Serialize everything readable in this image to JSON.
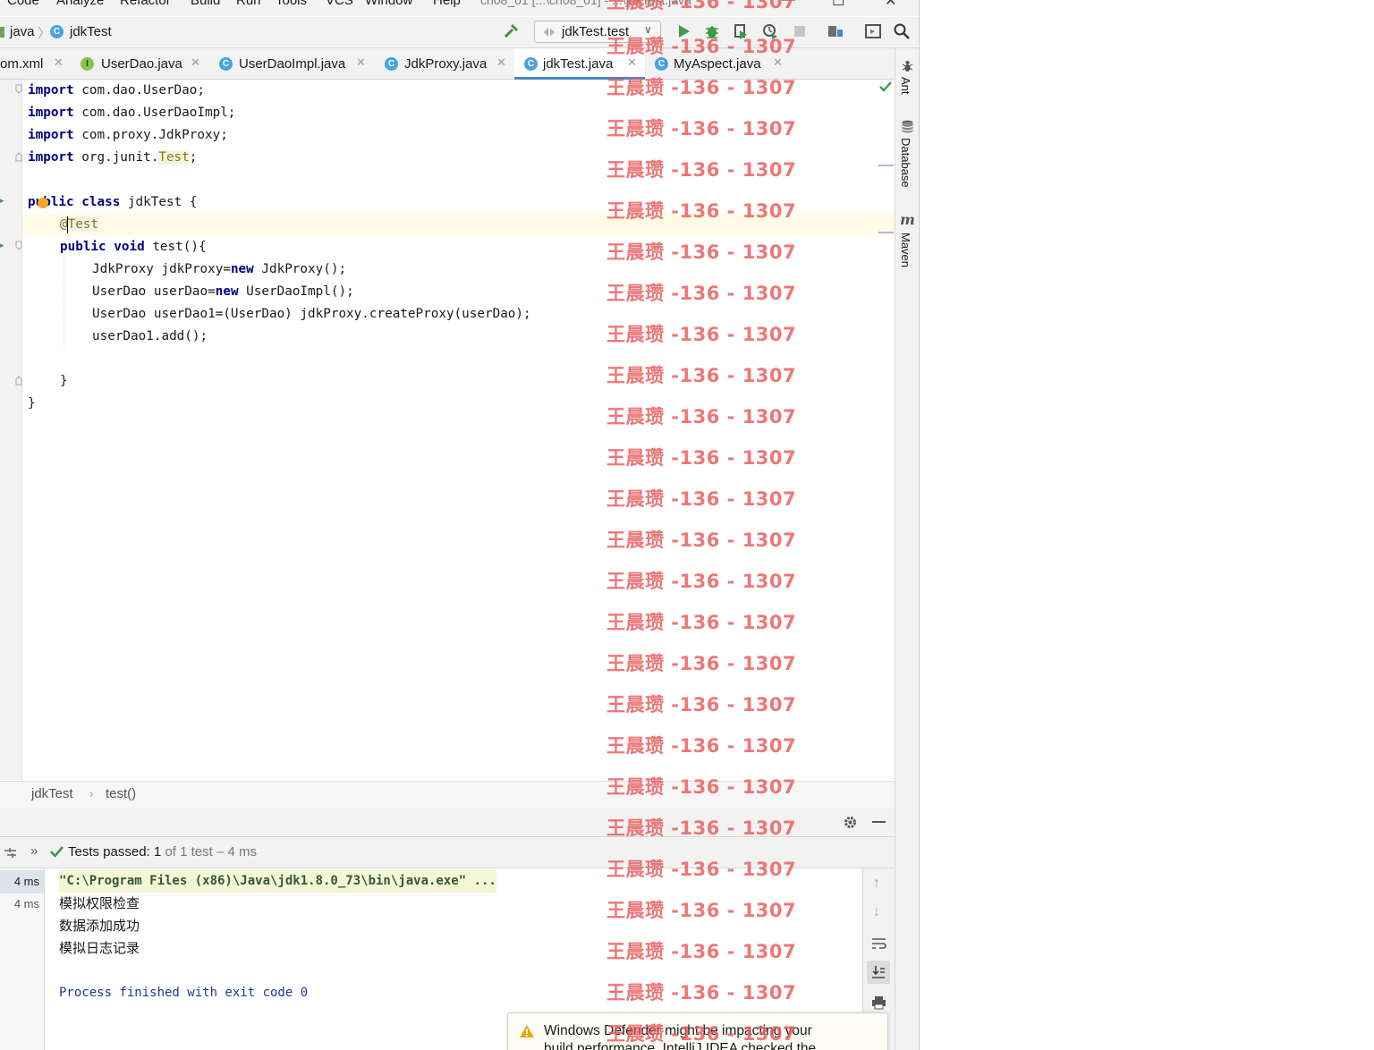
{
  "menu": {
    "items": [
      "Code",
      "Analyze",
      "Refactor",
      "Build",
      "Run",
      "Tools",
      "VCS",
      "Window",
      "Help"
    ],
    "window_title": "ch08_01 [...\\ch08_01] - ...\\jdkTest.java"
  },
  "navbar": {
    "crumbs": [
      "java",
      "jdkTest"
    ],
    "run_config": "jdkTest.test"
  },
  "tabs": [
    {
      "label": "om.xml",
      "icon": "",
      "active": false
    },
    {
      "label": "UserDao.java",
      "icon": "I",
      "active": false
    },
    {
      "label": "UserDaoImpl.java",
      "icon": "C",
      "active": false
    },
    {
      "label": "JdkProxy.java",
      "icon": "C",
      "active": false
    },
    {
      "label": "jdkTest.java",
      "icon": "C",
      "active": true
    },
    {
      "label": "MyAspect.java",
      "icon": "C",
      "active": false
    }
  ],
  "right_tools": [
    "Ant",
    "Database",
    "Maven"
  ],
  "code": {
    "import1": "com.dao.UserDao;",
    "import2": "com.dao.UserDaoImpl;",
    "import3": "com.proxy.JdkProxy;",
    "import4_pre": "org.junit.",
    "import4_cls": "Test",
    "import4_post": ";",
    "kw_import": "import",
    "kw_public": "public",
    "kw_class": "class",
    "kw_void": "void",
    "kw_new": "new",
    "class_decl": "jdkTest {",
    "annotation": "@Test",
    "method_decl": "test(){",
    "line_a_pre": "JdkProxy jdkProxy=",
    "line_a_post": "JdkProxy();",
    "line_b_pre": "UserDao userDao=",
    "line_b_post": "UserDaoImpl();",
    "line_c": "UserDao userDao1=(UserDao) jdkProxy.createProxy(userDao);",
    "line_d": "userDao1.add();",
    "close_method": "}",
    "close_class": "}"
  },
  "breadcrumb": {
    "class": "jdkTest",
    "method": "test()"
  },
  "run": {
    "status_bold": "Tests passed:",
    "status_count": "1",
    "status_rest": "of 1 test – 4 ms"
  },
  "tree": [
    "4 ms",
    "4 ms"
  ],
  "console": {
    "cmd": "\"C:\\Program Files (x86)\\Java\\jdk1.8.0_73\\bin\\java.exe\" ...",
    "out1": "模拟权限检查",
    "out2": "数据添加成功",
    "out3": "模拟日志记录",
    "process": "Process finished with exit code 0"
  },
  "notification": {
    "line1": "Windows Defender might be impacting your",
    "line2": "build performance. IntelliJ IDEA checked the"
  },
  "watermark": "王晨瓒 -136 - 1307",
  "colors": {
    "keyword": "#000080",
    "annotation": "#808000",
    "success": "#3c9a48",
    "watermark": "#e85a5a",
    "accent": "#4a86c8"
  }
}
